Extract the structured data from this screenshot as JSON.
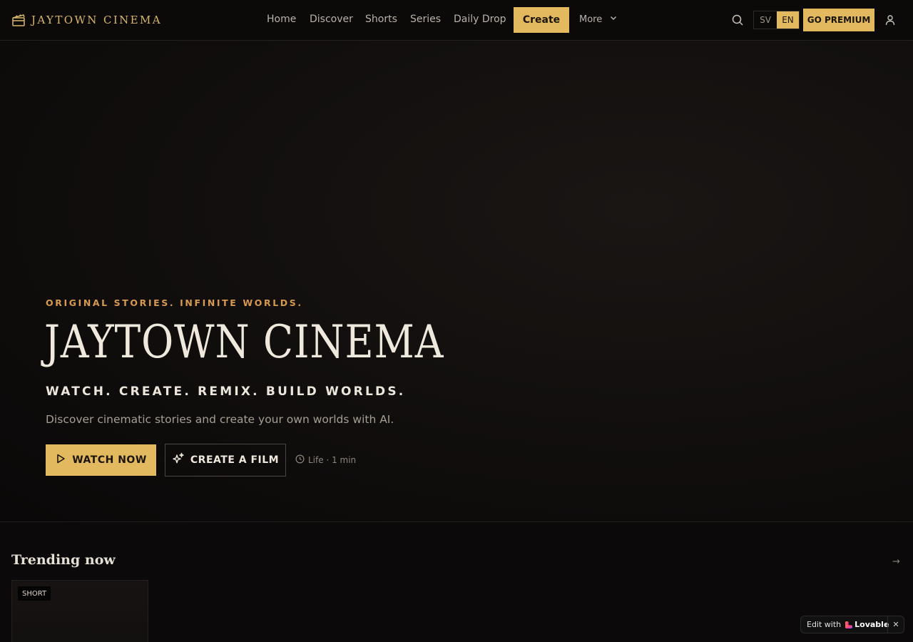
{
  "brand": {
    "name": "JAYTOWN CINEMA",
    "icon": "clapperboard-icon",
    "color": "#d9b76a"
  },
  "nav": {
    "links": [
      "Home",
      "Discover",
      "Shorts",
      "Series",
      "Daily Drop"
    ],
    "create_label": "Create",
    "more_label": "More",
    "search_icon": "search-icon",
    "lang": {
      "sv": "SV",
      "en": "EN",
      "selected": "EN"
    },
    "premium_label": "GO PREMIUM",
    "user_icon": "user-icon"
  },
  "hero": {
    "tagline": "ORIGINAL STORIES. INFINITE WORLDS.",
    "title": "JAYTOWN CINEMA",
    "slogan": "WATCH. CREATE. REMIX. BUILD WORLDS.",
    "description": "Discover cinematic stories and create your own worlds with AI.",
    "watch_label": "WATCH NOW",
    "create_film_label": "CREATE A FILM",
    "meta": "Life · 1 min"
  },
  "trending": {
    "title": "Trending now",
    "arrow": "→",
    "cards": [
      {
        "badge": "SHORT"
      }
    ]
  },
  "lovable": {
    "edit_text": "Edit with",
    "brand": "Lovable",
    "close": "✕"
  },
  "colors": {
    "accent": "#e2b95e",
    "tagline": "#d79a4f",
    "background": "#0b0909"
  }
}
